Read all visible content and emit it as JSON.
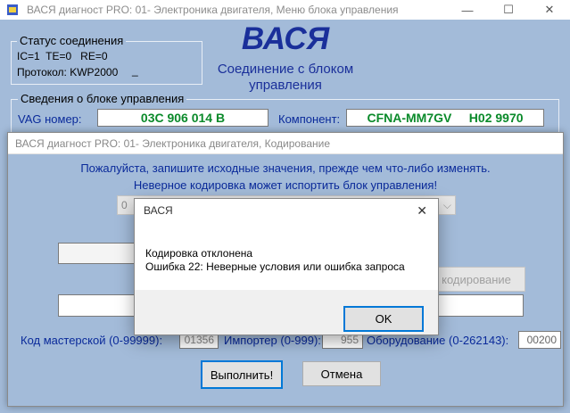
{
  "main_window": {
    "title": "ВАСЯ диагност PRO: 01- Электроника двигателя,  Меню блока управления",
    "status": {
      "legend": "Статус соединения",
      "line1": "IC=1  TE=0   RE=0",
      "protocol": "Протокол: KWP2000",
      "protocol_suffix": "_"
    },
    "logo": "ВАСЯ",
    "connection": "Соединение с блоком управления",
    "ecu": {
      "legend": "Сведения о блоке управления",
      "vag_label": "VAG номер:",
      "vag_value": "03C 906 014 B",
      "component_label": "Компонент:",
      "component_value": "CFNA-MM7GV     H02 9970"
    }
  },
  "coding_dialog": {
    "title": "ВАСЯ диагност PRO: 01- Электроника двигателя,  Кодирование",
    "warning1": "Пожалуйста, запишите исходные значения, прежде чем что-либо изменять.",
    "warning2": "Неверное кодировка может испортить блок управления!",
    "combo_value": "0",
    "coding_button": "кодирование",
    "workshop_label": "Код мастерской (0-99999):",
    "workshop_value": "01356",
    "importer_label": "Импортер (0-999):",
    "importer_value": "955",
    "equipment_label": "Оборудование (0-262143):",
    "equipment_value": "00200",
    "execute_button": "Выполнить!",
    "cancel_button": "Отмена"
  },
  "message_box": {
    "title": "ВАСЯ",
    "line1": "Кодировка отклонена",
    "line2": "Ошибка 22: Неверные условия или ошибка запроса",
    "ok_button": "OK"
  },
  "colors": {
    "background": "#a3bbd9",
    "logo": "#1a2f9a",
    "field_text": "#0a8a2a",
    "label_blue": "#0a2a9a"
  },
  "icons": [
    "app-icon",
    "minimize-icon",
    "maximize-icon",
    "close-icon",
    "chevron-down-icon"
  ]
}
